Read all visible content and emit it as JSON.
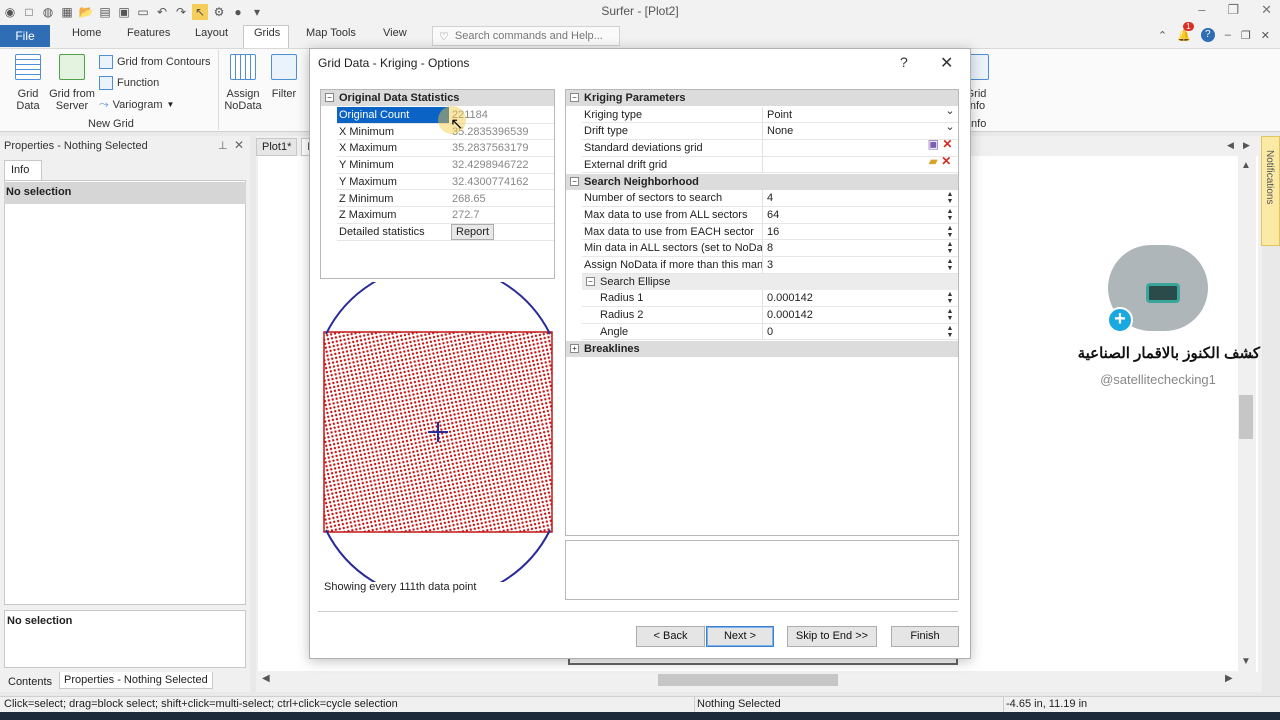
{
  "app": {
    "title": "Surfer - [Plot2]",
    "file_tab": "File",
    "tabs": [
      "Home",
      "Features",
      "Layout",
      "Grids",
      "Map Tools",
      "View"
    ],
    "search_placeholder": "Search commands and Help...",
    "notification_count": "1"
  },
  "ribbon": {
    "grid_data": [
      "Grid",
      "Data"
    ],
    "grid_from_server": [
      "Grid from",
      "Server"
    ],
    "grid_from_contours": "Grid from Contours",
    "function": "Function",
    "variogram": "Variogram",
    "group_new_grid": "New Grid",
    "assign_nodata": [
      "Assign",
      "NoData"
    ],
    "filter": "Filter",
    "grid_info": [
      "Grid",
      "Info"
    ],
    "group_info": "Info"
  },
  "properties_panel": {
    "title": "Properties - Nothing Selected",
    "tab": "Info",
    "no_selection_top": "No selection",
    "no_selection_bottom": "No selection",
    "bottom_tab_contents": "Contents",
    "bottom_tab_properties": "Properties - Nothing Selected"
  },
  "document": {
    "tabs": [
      "Plot1*",
      "P"
    ]
  },
  "dialog": {
    "title": "Grid Data - Kriging - Options",
    "stats_title": "Original Data Statistics",
    "stats": [
      {
        "name": "Original Count",
        "value": "221184"
      },
      {
        "name": "X Minimum",
        "value": "35.2835396539"
      },
      {
        "name": "X Maximum",
        "value": "35.2837563179"
      },
      {
        "name": "Y Minimum",
        "value": "32.4298946722"
      },
      {
        "name": "Y Maximum",
        "value": "32.4300774162"
      },
      {
        "name": "Z Minimum",
        "value": "268.65"
      },
      {
        "name": "Z Maximum",
        "value": "272.7"
      }
    ],
    "detailed_statistics": "Detailed statistics",
    "report_button": "Report",
    "showing_text": "Showing every 111th data point",
    "kriging_section": "Kriging Parameters",
    "kriging": [
      {
        "name": "Kriging type",
        "value": "Point"
      },
      {
        "name": "Drift type",
        "value": "None"
      },
      {
        "name": "Standard deviations grid",
        "value": ""
      },
      {
        "name": "External drift grid",
        "value": ""
      }
    ],
    "search_section": "Search Neighborhood",
    "search": [
      {
        "name": "Number of sectors to search",
        "value": "4"
      },
      {
        "name": "Max data to use from ALL sectors",
        "value": "64"
      },
      {
        "name": "Max data to use from EACH sector",
        "value": "16"
      },
      {
        "name": "Min data in ALL sectors (set to NoDat...",
        "value": "8"
      },
      {
        "name": "Assign NoData if more than this man...",
        "value": "3"
      }
    ],
    "ellipse_section": "Search Ellipse",
    "ellipse": [
      {
        "name": "Radius 1",
        "value": "0.000142"
      },
      {
        "name": "Radius 2",
        "value": "0.000142"
      },
      {
        "name": "Angle",
        "value": "0"
      }
    ],
    "breaklines_section": "Breaklines",
    "buttons": {
      "back": "< Back",
      "next": "Next >",
      "skip": "Skip to End >>",
      "finish": "Finish"
    }
  },
  "statusbar": {
    "hint": "Click=select; drag=block select; shift+click=multi-select; ctrl+click=cycle selection",
    "selection": "Nothing Selected",
    "coords": "-4.65 in, 11.19 in"
  },
  "side_notifications": "Notifications",
  "overlay": {
    "arabic_title": "كشف الكنوز بالاقمار الصناعية",
    "handle": "@satellitechecking1"
  },
  "colors": {
    "accent": "#2f6db5",
    "selection": "#0b63c5",
    "points": "#c41515",
    "ellipse": "#2a2a9a"
  }
}
